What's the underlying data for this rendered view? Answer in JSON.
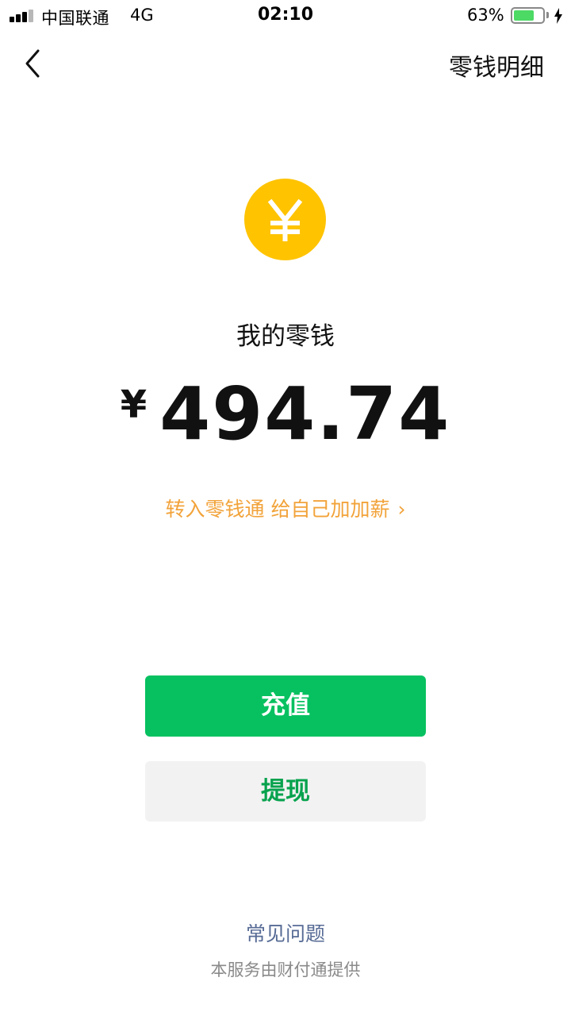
{
  "status_bar": {
    "carrier": "中国联通",
    "network": "4G",
    "time": "02:10",
    "battery_percent": "63%",
    "battery_level": 0.63,
    "icons": [
      "signal-icon",
      "battery-icon",
      "charging-icon"
    ]
  },
  "nav": {
    "back_icon": "chevron-left-icon",
    "right_link": "零钱明细"
  },
  "wallet": {
    "coin_icon": "yuan-coin-icon",
    "coin_color": "#ffc300",
    "label": "我的零钱",
    "currency_symbol": "¥",
    "balance": "494.74",
    "promo_text": "转入零钱通 给自己加加薪",
    "promo_chevron": "›",
    "promo_color": "#f2a33a"
  },
  "actions": {
    "recharge_label": "充值",
    "withdraw_label": "提现",
    "primary_color": "#07c160"
  },
  "footer": {
    "faq_label": "常见问题",
    "provider_text": "本服务由财付通提供"
  }
}
